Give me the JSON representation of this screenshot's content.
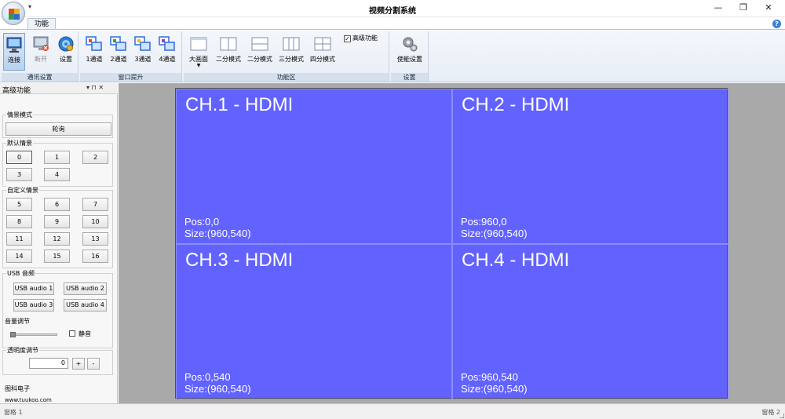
{
  "window": {
    "title": "视频分割系统",
    "minimize": "—",
    "restore": "❐",
    "close": "✕"
  },
  "tabs": {
    "function_label": "功能",
    "help": "?"
  },
  "ribbon": {
    "groups": {
      "comm": {
        "label": "通讯设置",
        "connect": "连接",
        "disconnect": "断开",
        "settings": "设置"
      },
      "window_raise": {
        "label": "窗口提升",
        "ch1": "1通道",
        "ch2": "2通道",
        "ch3": "3通道",
        "ch4": "4通道"
      },
      "function_area": {
        "label": "功能区",
        "big_screen": "大画面",
        "split2a": "二分模式",
        "split2b": "二分模式",
        "split3": "三分模式",
        "split4": "四分模式",
        "advanced": "高级功能",
        "advanced_checked": true
      },
      "settings": {
        "label": "设置",
        "enable_settings": "使能设置"
      }
    }
  },
  "side_panel": {
    "title": "高级功能",
    "pin": "▾  ⊓  ✕",
    "scene_mode": {
      "legend": "情景模式",
      "polling": "轮询"
    },
    "default_scene": {
      "legend": "默认情景",
      "buttons": [
        "0",
        "1",
        "2",
        "3",
        "4"
      ]
    },
    "custom_scene": {
      "legend": "自定义情景",
      "buttons": [
        "5",
        "6",
        "7",
        "8",
        "9",
        "10",
        "11",
        "12",
        "13",
        "14",
        "15",
        "16"
      ]
    },
    "usb_audio": {
      "legend": "USB 音频",
      "buttons": [
        "USB audio 1",
        "USB audio 2",
        "USB audio 3",
        "USB audio 4"
      ]
    },
    "volume": {
      "label": "音量调节",
      "mute": "静音"
    },
    "transparency": {
      "legend": "透明度调节",
      "value": "0",
      "plus": "+",
      "minus": "-"
    },
    "company": "图科电子",
    "website": "www.tuukoo.com"
  },
  "channels": [
    {
      "title": "CH.1 - HDMI",
      "pos": "Pos:0,0",
      "size": "Size:(960,540)"
    },
    {
      "title": "CH.2 - HDMI",
      "pos": "Pos:960,0",
      "size": "Size:(960,540)"
    },
    {
      "title": "CH.3 - HDMI",
      "pos": "Pos:0,540",
      "size": "Size:(960,540)"
    },
    {
      "title": "CH.4 - HDMI",
      "pos": "Pos:960,540",
      "size": "Size:(960,540)"
    }
  ],
  "status": {
    "left": "窗格 1",
    "right": "窗格 2"
  },
  "colors": {
    "screen_bg": "#6262ff",
    "workspace_bg": "#a9a9a9",
    "ribbon_group_label": "#d6e0ec"
  }
}
